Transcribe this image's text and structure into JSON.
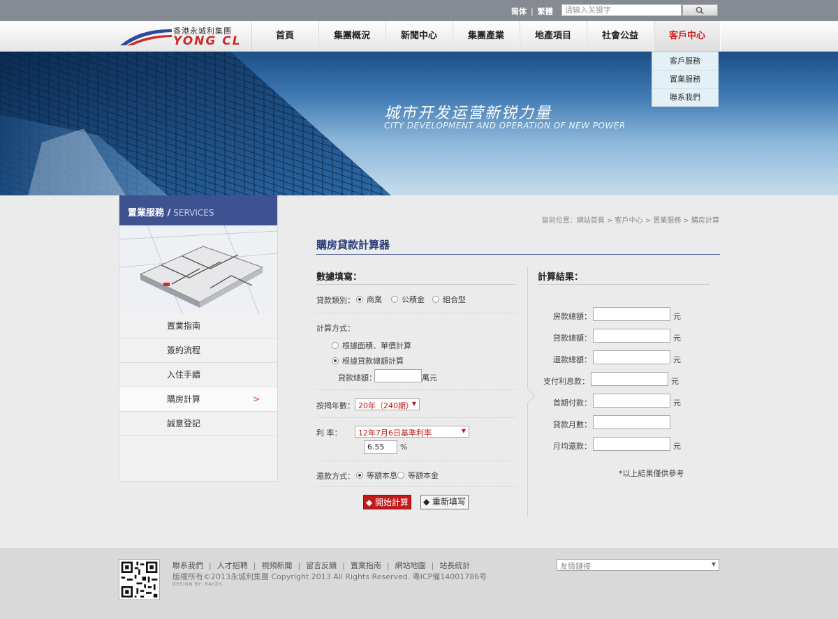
{
  "header": {
    "lang_simplified": "简体",
    "lang_traditional": "繁體",
    "search_placeholder": "请输入关键字",
    "logo_cn": "香港永城利集團",
    "logo_en": "YONG CL",
    "nav": [
      "首頁",
      "集團概況",
      "新聞中心",
      "集團產業",
      "地產項目",
      "社會公益",
      "客戶中心"
    ],
    "dropdown": [
      "客戶服務",
      "置業服務",
      "聯系我們"
    ]
  },
  "banner": {
    "slogan": "城市开发运营新锐力量",
    "sub": "CITY DEVELOPMENT AND OPERATION OF NEW POWER"
  },
  "sidebar": {
    "title": "置業服務",
    "slash": "/",
    "sub": "SERVICES",
    "items": [
      "置業指南",
      "簽約流程",
      "入住手續",
      "購房計算",
      "誠意登記"
    ]
  },
  "breadcrumb": "當前位置：網站首頁 > 客戶中心 > 置業服務 > 購房計算",
  "calc": {
    "title": "購房貸款計算器",
    "left_head": "數據填寫：",
    "right_head": "計算結果：",
    "loan_type_label": "貸款類別：",
    "loan_types": [
      "商業",
      "公積金",
      "組合型"
    ],
    "method_label": "計算方式：",
    "methods": [
      "根據面積、單價計算",
      "根據貸款總額計算"
    ],
    "total_label": "貸款總額：",
    "total_unit": "萬元",
    "years_label": "按揭年數：",
    "years_value": "20年（240期）",
    "rate_label": "利 率：",
    "rate_select": "12年7月6日基準利率",
    "rate_value": "6.55",
    "rate_unit": "%",
    "repay_label": "還款方式：",
    "repay_types": [
      "等額本息",
      "等額本金"
    ],
    "start_btn": "開始計算",
    "reset_btn": "重新填写",
    "results": [
      {
        "label": "房款總額：",
        "unit": "元"
      },
      {
        "label": "貸款總額：",
        "unit": "元"
      },
      {
        "label": "還款總額：",
        "unit": "元"
      },
      {
        "label": "支付利息款：",
        "unit": "元"
      },
      {
        "label": "首期付款：",
        "unit": "元"
      },
      {
        "label": "貸款月數：",
        "unit": ""
      },
      {
        "label": "月均還款：",
        "unit": "元"
      }
    ],
    "note": "*以上結果僅供參考"
  },
  "footer": {
    "links": [
      "聯系我們",
      "人才招聘",
      "視頻新聞",
      "留言反饋",
      "置業指南",
      "網站地圖",
      "站長統計"
    ],
    "copyright": "版權所有©2013永城利集團   Copyright 2013 All Rights Reserved.   粵ICP備14001786号",
    "design": "DESIGN BY: RAYZH",
    "friend_links": "友情鏈接"
  }
}
